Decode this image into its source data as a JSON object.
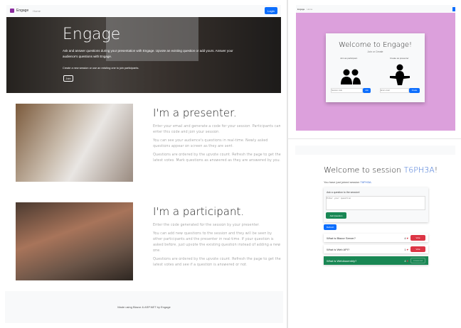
{
  "home": {
    "brand": "Engage",
    "nav_home": "Home",
    "login": "Login",
    "hero": {
      "title": "Engage",
      "text": "Ask and answer questions during your presentation with Engage. Upvote an existing question or add yours. Answer your audience's questions with Engage.",
      "sub": "Create a new session or use an existing one to join participants.",
      "join": "Join"
    },
    "presenter": {
      "title": "I'm a presenter.",
      "p": [
        "Enter your email and generate a code for your session. Participants can enter this code and join your session.",
        "You can see your audience's questions in real-time. Newly asked questions appear on screen as they are sent.",
        "Questions are ordered by the upvote count. Refresh the page to get the latest votes. Mark questions as answered as they are answered by you."
      ]
    },
    "participant": {
      "title": "I'm a participant.",
      "p": [
        "Enter the code generated for the session by your presenter.",
        "You can add new questions to the session and they will be seen by other participants and the presenter in real-time. If your question is asked before, just upvote the existing question instead of adding a new one.",
        "Questions are ordered by the upvote count. Refresh the page to get the latest votes and see if a question is answered or not."
      ]
    },
    "footer": "Made using Blazor & ASP.NET by Engage"
  },
  "welcome": {
    "brand": "Engage",
    "nav_home": "Home",
    "title": "Welcome to Engage!",
    "subtitle": "Join or Create",
    "participant_label": "Join as participant",
    "presenter_label": "Create as presenter",
    "code_placeholder": "Session code",
    "join": "Join",
    "email_placeholder": "Enter email",
    "create": "Create",
    "bg": "#dca0dc"
  },
  "session": {
    "title_prefix": "Welcome to session ",
    "code": "T6PH3A",
    "title_suffix": "!",
    "joined_prefix": "You have just joined session ",
    "joined_code": "T6PH3A.",
    "ask_label": "Ask a question to the session!",
    "placeholder": "Enter your question",
    "ask_button": "Ask Question",
    "refresh": "Refresh",
    "questions": [
      {
        "text": "What is Blazor Server?",
        "votes": "4",
        "action": "Vote"
      },
      {
        "text": "What is Web API?",
        "votes": "1",
        "action": "Vote"
      },
      {
        "text": "What is WebAssembly?",
        "votes": "4",
        "action": "Answered"
      }
    ]
  }
}
